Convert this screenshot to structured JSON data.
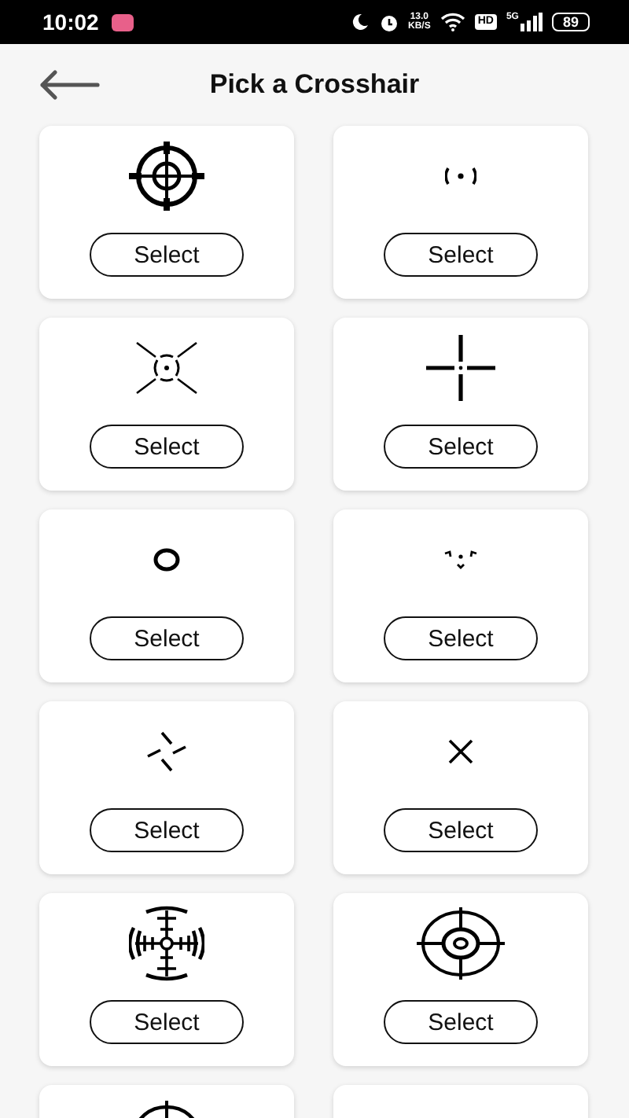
{
  "status_bar": {
    "time": "10:02",
    "speed_value": "13.0",
    "speed_unit": "KB/S",
    "hd": "HD",
    "network": "5G",
    "battery": "89"
  },
  "header": {
    "title": "Pick a Crosshair"
  },
  "crosshairs": [
    {
      "kind": "scope",
      "button": "Select"
    },
    {
      "kind": "brackets",
      "button": "Select"
    },
    {
      "kind": "burst",
      "button": "Select"
    },
    {
      "kind": "cross",
      "button": "Select"
    },
    {
      "kind": "ring",
      "button": "Select"
    },
    {
      "kind": "chevrons",
      "button": "Select"
    },
    {
      "kind": "pinwheel",
      "button": "Select"
    },
    {
      "kind": "x",
      "button": "Select"
    },
    {
      "kind": "radar",
      "button": "Select"
    },
    {
      "kind": "target",
      "button": "Select"
    },
    {
      "kind": "partial-target"
    },
    {
      "kind": "blank"
    }
  ]
}
